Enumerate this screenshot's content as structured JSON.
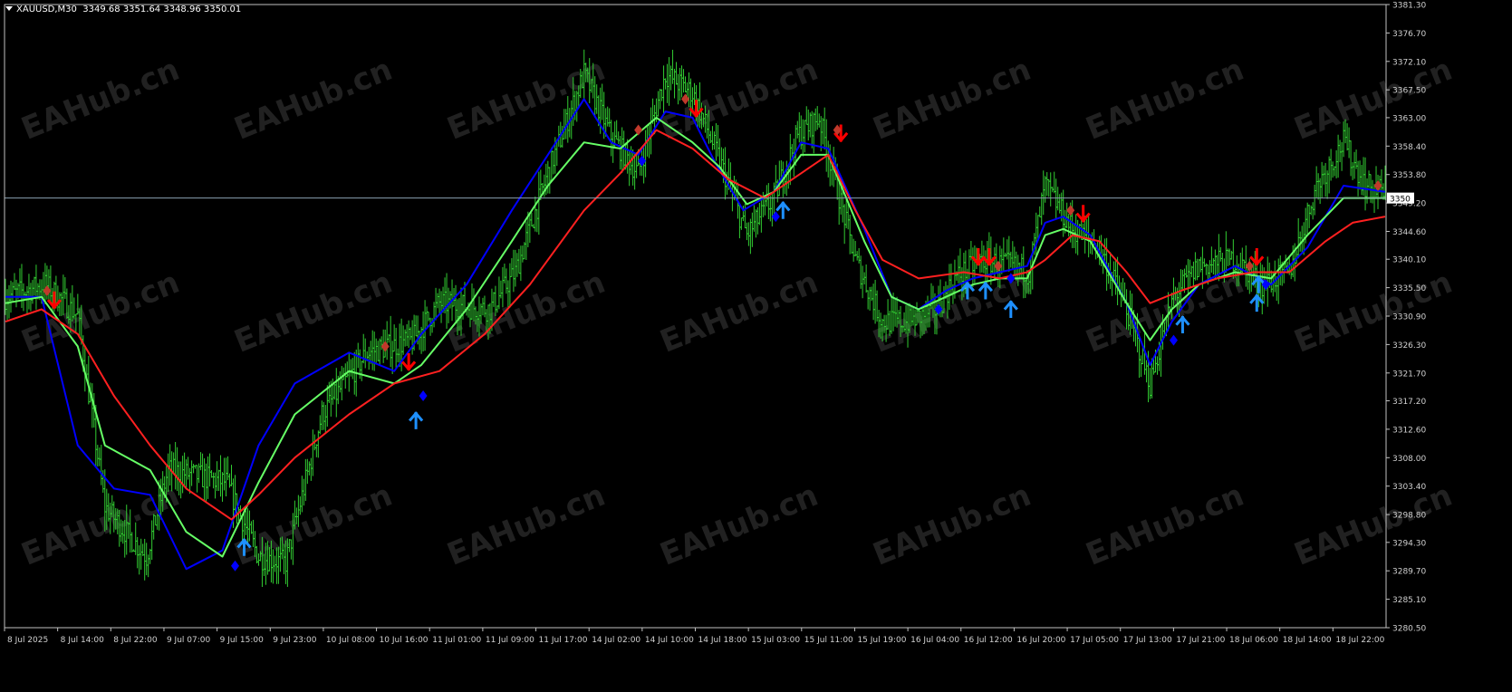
{
  "header": {
    "symbol_timeframe": "XAUUSD,M30",
    "ohlc": "3349.68 3351.64 3348.96 3350.01"
  },
  "watermark": "EAHub.cn",
  "colors": {
    "background": "#000000",
    "axis": "#c0c0c0",
    "bars": "#32cd32",
    "ma_blue": "#0000ff",
    "ma_green": "#66ff66",
    "ma_red": "#ff2020",
    "arrow_down": "#ff0000",
    "arrow_up": "#1e90ff",
    "diamond_red": "#c0392b",
    "diamond_blue": "#0000ff",
    "price_line": "#8aa0b0"
  },
  "chart_data": {
    "type": "ohlc-bars",
    "symbol": "XAUUSD",
    "timeframe": "M30",
    "current_price": 3350,
    "current_price_label": "3350",
    "ylim": [
      3280.5,
      3381.3
    ],
    "y_ticks": [
      3381.3,
      3376.7,
      3372.1,
      3367.5,
      3363.0,
      3358.4,
      3353.8,
      3349.2,
      3344.6,
      3340.1,
      3335.5,
      3330.9,
      3326.3,
      3321.7,
      3317.2,
      3312.6,
      3308.0,
      3303.4,
      3298.8,
      3294.3,
      3289.7,
      3285.1,
      3280.5
    ],
    "y_tick_labels": [
      "3381.30",
      "3376.70",
      "3372.10",
      "3367.50",
      "3363.00",
      "3358.40",
      "3353.80",
      "3349.20",
      "3344.60",
      "3340.10",
      "3335.50",
      "3330.90",
      "3326.30",
      "3321.70",
      "3317.20",
      "3312.60",
      "3308.00",
      "3303.40",
      "3298.80",
      "3294.30",
      "3289.70",
      "3285.10",
      "3280.50"
    ],
    "x_tick_labels": [
      "8 Jul 2025",
      "8 Jul 14:00",
      "8 Jul 22:00",
      "9 Jul 07:00",
      "9 Jul 15:00",
      "9 Jul 23:00",
      "10 Jul 08:00",
      "10 Jul 16:00",
      "11 Jul 01:00",
      "11 Jul 09:00",
      "11 Jul 17:00",
      "14 Jul 02:00",
      "14 Jul 10:00",
      "14 Jul 18:00",
      "15 Jul 03:00",
      "15 Jul 11:00",
      "15 Jul 19:00",
      "16 Jul 04:00",
      "16 Jul 12:00",
      "16 Jul 20:00",
      "17 Jul 05:00",
      "17 Jul 13:00",
      "17 Jul 21:00",
      "18 Jul 06:00",
      "18 Jul 14:00",
      "18 Jul 22:00"
    ],
    "price_path_keypoints": [
      [
        0,
        3334
      ],
      [
        22,
        3336
      ],
      [
        40,
        3331
      ],
      [
        55,
        3300
      ],
      [
        78,
        3292
      ],
      [
        90,
        3306
      ],
      [
        122,
        3304
      ],
      [
        140,
        3292
      ],
      [
        155,
        3291
      ],
      [
        175,
        3315
      ],
      [
        200,
        3325
      ],
      [
        225,
        3327
      ],
      [
        240,
        3333
      ],
      [
        268,
        3332
      ],
      [
        282,
        3338
      ],
      [
        300,
        3354
      ],
      [
        320,
        3370
      ],
      [
        335,
        3360
      ],
      [
        350,
        3354
      ],
      [
        365,
        3370
      ],
      [
        380,
        3367
      ],
      [
        395,
        3356
      ],
      [
        410,
        3344
      ],
      [
        425,
        3350
      ],
      [
        438,
        3360
      ],
      [
        450,
        3363
      ],
      [
        470,
        3340
      ],
      [
        485,
        3330
      ],
      [
        500,
        3330
      ],
      [
        515,
        3332
      ],
      [
        525,
        3337
      ],
      [
        540,
        3340
      ],
      [
        556,
        3339
      ],
      [
        566,
        3338
      ],
      [
        575,
        3352
      ],
      [
        590,
        3345
      ],
      [
        605,
        3342
      ],
      [
        620,
        3332
      ],
      [
        633,
        3320
      ],
      [
        646,
        3334
      ],
      [
        660,
        3339
      ],
      [
        680,
        3340
      ],
      [
        695,
        3336
      ],
      [
        710,
        3338
      ],
      [
        725,
        3352
      ],
      [
        740,
        3359
      ],
      [
        752,
        3352
      ],
      [
        763,
        3351
      ]
    ],
    "series": [
      {
        "name": "",
        "role": "ma_fast",
        "color": "#0000ff",
        "points": [
          [
            0,
            3334
          ],
          [
            20,
            3334
          ],
          [
            40,
            3310
          ],
          [
            60,
            3303
          ],
          [
            80,
            3302
          ],
          [
            100,
            3290
          ],
          [
            120,
            3293
          ],
          [
            140,
            3310
          ],
          [
            160,
            3320
          ],
          [
            190,
            3325
          ],
          [
            215,
            3322
          ],
          [
            230,
            3328
          ],
          [
            255,
            3336
          ],
          [
            280,
            3348
          ],
          [
            300,
            3357
          ],
          [
            320,
            3366
          ],
          [
            335,
            3359
          ],
          [
            350,
            3357
          ],
          [
            365,
            3364
          ],
          [
            380,
            3363
          ],
          [
            392,
            3356
          ],
          [
            408,
            3348
          ],
          [
            425,
            3351
          ],
          [
            440,
            3359
          ],
          [
            455,
            3358
          ],
          [
            475,
            3345
          ],
          [
            490,
            3334
          ],
          [
            505,
            3332
          ],
          [
            520,
            3335
          ],
          [
            535,
            3337
          ],
          [
            550,
            3338
          ],
          [
            565,
            3339
          ],
          [
            575,
            3346
          ],
          [
            585,
            3347
          ],
          [
            600,
            3344
          ],
          [
            620,
            3333
          ],
          [
            633,
            3323
          ],
          [
            645,
            3330
          ],
          [
            660,
            3336
          ],
          [
            680,
            3339
          ],
          [
            700,
            3336
          ],
          [
            720,
            3342
          ],
          [
            740,
            3352
          ],
          [
            763,
            3351
          ]
        ]
      },
      {
        "name": "",
        "role": "ma_mid",
        "color": "#66ff66",
        "points": [
          [
            0,
            3333
          ],
          [
            20,
            3334
          ],
          [
            40,
            3326
          ],
          [
            55,
            3310
          ],
          [
            80,
            3306
          ],
          [
            100,
            3296
          ],
          [
            120,
            3292
          ],
          [
            140,
            3304
          ],
          [
            160,
            3315
          ],
          [
            190,
            3322
          ],
          [
            215,
            3320
          ],
          [
            230,
            3323
          ],
          [
            255,
            3332
          ],
          [
            280,
            3343
          ],
          [
            300,
            3352
          ],
          [
            320,
            3359
          ],
          [
            340,
            3358
          ],
          [
            360,
            3363
          ],
          [
            380,
            3359
          ],
          [
            395,
            3355
          ],
          [
            410,
            3349
          ],
          [
            425,
            3351
          ],
          [
            440,
            3357
          ],
          [
            455,
            3357
          ],
          [
            475,
            3343
          ],
          [
            490,
            3334
          ],
          [
            505,
            3332
          ],
          [
            520,
            3334
          ],
          [
            535,
            3336
          ],
          [
            550,
            3337
          ],
          [
            565,
            3337
          ],
          [
            575,
            3344
          ],
          [
            585,
            3345
          ],
          [
            600,
            3343
          ],
          [
            620,
            3333
          ],
          [
            633,
            3327
          ],
          [
            645,
            3332
          ],
          [
            660,
            3336
          ],
          [
            680,
            3338
          ],
          [
            700,
            3337
          ],
          [
            720,
            3344
          ],
          [
            740,
            3350
          ],
          [
            763,
            3350
          ]
        ]
      },
      {
        "name": "",
        "role": "ma_slow",
        "color": "#ff2020",
        "points": [
          [
            0,
            3330
          ],
          [
            20,
            3332
          ],
          [
            40,
            3328
          ],
          [
            60,
            3318
          ],
          [
            80,
            3310
          ],
          [
            100,
            3303
          ],
          [
            125,
            3298
          ],
          [
            140,
            3302
          ],
          [
            160,
            3308
          ],
          [
            190,
            3315
          ],
          [
            215,
            3320
          ],
          [
            240,
            3322
          ],
          [
            265,
            3328
          ],
          [
            290,
            3336
          ],
          [
            320,
            3348
          ],
          [
            340,
            3354
          ],
          [
            360,
            3361
          ],
          [
            380,
            3358
          ],
          [
            400,
            3353
          ],
          [
            420,
            3350
          ],
          [
            440,
            3354
          ],
          [
            455,
            3357
          ],
          [
            470,
            3348
          ],
          [
            485,
            3340
          ],
          [
            505,
            3337
          ],
          [
            530,
            3338
          ],
          [
            550,
            3337
          ],
          [
            565,
            3338
          ],
          [
            575,
            3340
          ],
          [
            590,
            3344
          ],
          [
            605,
            3343
          ],
          [
            620,
            3338
          ],
          [
            633,
            3333
          ],
          [
            650,
            3335
          ],
          [
            670,
            3337
          ],
          [
            690,
            3338
          ],
          [
            710,
            3338
          ],
          [
            730,
            3343
          ],
          [
            745,
            3346
          ],
          [
            763,
            3347
          ]
        ]
      }
    ],
    "signals": [
      {
        "kind": "diamond",
        "color": "red",
        "x": 23,
        "y": 3335.0
      },
      {
        "kind": "arrow-down",
        "color": "red",
        "x": 27,
        "y": 3333.5
      },
      {
        "kind": "arrow-up",
        "color": "blue",
        "x": 132,
        "y": 3293.5
      },
      {
        "kind": "diamond",
        "color": "blue",
        "x": 127,
        "y": 3290.5
      },
      {
        "kind": "diamond",
        "color": "red",
        "x": 210,
        "y": 3326.0
      },
      {
        "kind": "arrow-down",
        "color": "red",
        "x": 223,
        "y": 3323.5
      },
      {
        "kind": "diamond",
        "color": "blue",
        "x": 231,
        "y": 3318.0
      },
      {
        "kind": "arrow-up",
        "color": "blue",
        "x": 227,
        "y": 3314.0
      },
      {
        "kind": "diamond",
        "color": "red",
        "x": 350,
        "y": 3361.0
      },
      {
        "kind": "diamond",
        "color": "blue",
        "x": 352,
        "y": 3356.0
      },
      {
        "kind": "diamond",
        "color": "red",
        "x": 376,
        "y": 3366.0
      },
      {
        "kind": "arrow-down",
        "color": "red",
        "x": 382,
        "y": 3364.5
      },
      {
        "kind": "arrow-up",
        "color": "blue",
        "x": 430,
        "y": 3348.0
      },
      {
        "kind": "diamond",
        "color": "blue",
        "x": 426,
        "y": 3347.0
      },
      {
        "kind": "arrow-down",
        "color": "red",
        "x": 462,
        "y": 3360.5
      },
      {
        "kind": "diamond",
        "color": "red",
        "x": 460,
        "y": 3361.0
      },
      {
        "kind": "diamond",
        "color": "blue",
        "x": 516,
        "y": 3332.0
      },
      {
        "kind": "arrow-up",
        "color": "blue",
        "x": 532,
        "y": 3335.0
      },
      {
        "kind": "arrow-up",
        "color": "blue",
        "x": 542,
        "y": 3335.0
      },
      {
        "kind": "arrow-down",
        "color": "red",
        "x": 538,
        "y": 3340.5
      },
      {
        "kind": "arrow-down",
        "color": "red",
        "x": 544,
        "y": 3340.5
      },
      {
        "kind": "diamond",
        "color": "red",
        "x": 549,
        "y": 3339.0
      },
      {
        "kind": "diamond",
        "color": "blue",
        "x": 556,
        "y": 3337.0
      },
      {
        "kind": "arrow-up",
        "color": "blue",
        "x": 556,
        "y": 3332.0
      },
      {
        "kind": "diamond",
        "color": "red",
        "x": 589,
        "y": 3348.0
      },
      {
        "kind": "arrow-down",
        "color": "red",
        "x": 596,
        "y": 3347.5
      },
      {
        "kind": "diamond",
        "color": "blue",
        "x": 646,
        "y": 3327.0
      },
      {
        "kind": "arrow-up",
        "color": "blue",
        "x": 651,
        "y": 3329.5
      },
      {
        "kind": "diamond",
        "color": "red",
        "x": 688,
        "y": 3339.0
      },
      {
        "kind": "arrow-down",
        "color": "red",
        "x": 692,
        "y": 3340.5
      },
      {
        "kind": "arrow-up",
        "color": "blue",
        "x": 693,
        "y": 3336.0
      },
      {
        "kind": "diamond",
        "color": "blue",
        "x": 697,
        "y": 3336.0
      },
      {
        "kind": "arrow-up",
        "color": "blue",
        "x": 692,
        "y": 3333.0
      },
      {
        "kind": "diamond",
        "color": "red",
        "x": 759,
        "y": 3352.0
      }
    ],
    "grid": false,
    "legend": "none"
  }
}
